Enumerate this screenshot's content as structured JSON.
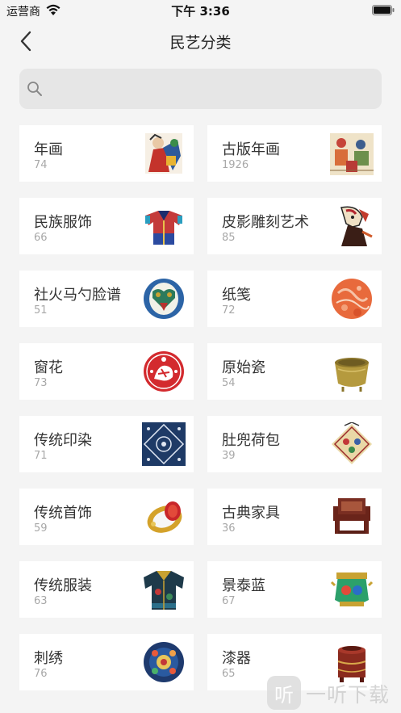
{
  "status_bar": {
    "carrier": "运营商",
    "time": "下午 3:36"
  },
  "nav": {
    "title": "民艺分类"
  },
  "search": {
    "placeholder": "",
    "value": ""
  },
  "categories": [
    {
      "name": "年画",
      "count": "74",
      "thumb": "nianhua"
    },
    {
      "name": "古版年画",
      "count": "1926",
      "thumb": "guban"
    },
    {
      "name": "民族服饰",
      "count": "66",
      "thumb": "fushi"
    },
    {
      "name": "皮影雕刻艺术",
      "count": "85",
      "thumb": "piying"
    },
    {
      "name": "社火马勺脸谱",
      "count": "51",
      "thumb": "mashao"
    },
    {
      "name": "纸笺",
      "count": "72",
      "thumb": "zhijian"
    },
    {
      "name": "窗花",
      "count": "73",
      "thumb": "chuanghua"
    },
    {
      "name": "原始瓷",
      "count": "54",
      "thumb": "yuanshici"
    },
    {
      "name": "传统印染",
      "count": "71",
      "thumb": "yinran"
    },
    {
      "name": "肚兜荷包",
      "count": "39",
      "thumb": "dudou"
    },
    {
      "name": "传统首饰",
      "count": "59",
      "thumb": "shoushi"
    },
    {
      "name": "古典家具",
      "count": "36",
      "thumb": "jiaju"
    },
    {
      "name": "传统服装",
      "count": "63",
      "thumb": "fuzhuang"
    },
    {
      "name": "景泰蓝",
      "count": "67",
      "thumb": "jingtailan"
    },
    {
      "name": "刺绣",
      "count": "76",
      "thumb": "cixiu"
    },
    {
      "name": "漆器",
      "count": "65",
      "thumb": "qiqi"
    }
  ],
  "watermark": {
    "logo_glyph": "听",
    "text": "一听下载"
  }
}
